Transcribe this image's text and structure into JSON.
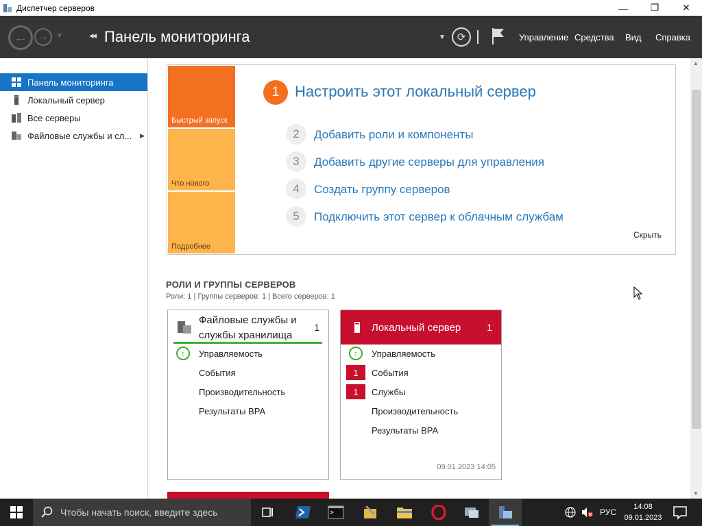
{
  "window": {
    "title": "Диспетчер серверов",
    "minimize": "—",
    "maximize": "❐",
    "close": "✕"
  },
  "header": {
    "back": "←",
    "forward": "→",
    "title": "Панель мониторинга",
    "menu": [
      "Управление",
      "Средства",
      "Вид",
      "Справка"
    ]
  },
  "sidebar": {
    "items": [
      {
        "label": "Панель мониторинга",
        "icon": "dashboard-icon",
        "active": true
      },
      {
        "label": "Локальный сервер",
        "icon": "server-icon"
      },
      {
        "label": "Все серверы",
        "icon": "servers-icon"
      },
      {
        "label": "Файловые службы и сл...",
        "icon": "file-services-icon",
        "expandable": true
      }
    ]
  },
  "welcome": {
    "tiles": [
      "Быстрый запуск",
      "Что нового",
      "Подробнее"
    ],
    "step1": {
      "number": "1",
      "label": "Настроить этот локальный сервер"
    },
    "steps": [
      {
        "number": "2",
        "label": "Добавить роли и компоненты"
      },
      {
        "number": "3",
        "label": "Добавить другие серверы для управления"
      },
      {
        "number": "4",
        "label": "Создать группу серверов"
      },
      {
        "number": "5",
        "label": "Подключить этот сервер к облачным службам"
      }
    ],
    "hide": "Скрыть"
  },
  "roles": {
    "title": "РОЛИ И ГРУППЫ СЕРВЕРОВ",
    "subtitle": "Роли: 1 | Группы серверов: 1 | Всего серверов: 1",
    "card1": {
      "title_line1": "Файловые службы и",
      "title_line2": "службы хранилища",
      "count": "1",
      "rows": [
        "Управляемость",
        "События",
        "Производительность",
        "Результаты BPA"
      ]
    },
    "card2": {
      "title": "Локальный сервер",
      "count": "1",
      "rows": [
        "Управляемость",
        "События",
        "Службы",
        "Производительность",
        "Результаты BPA"
      ],
      "events_count": "1",
      "services_count": "1",
      "timestamp": "09.01.2023 14:05"
    }
  },
  "taskbar": {
    "search_placeholder": "Чтобы начать поиск, введите здесь",
    "lang": "РУС",
    "time": "14:08",
    "date": "09.01.2023"
  },
  "colors": {
    "accent": "#1874c6",
    "header": "#353535",
    "orange": "#f37021",
    "light_orange": "#fdb44b",
    "red": "#c8102e",
    "green": "#3cb034",
    "link": "#2a78b8"
  }
}
